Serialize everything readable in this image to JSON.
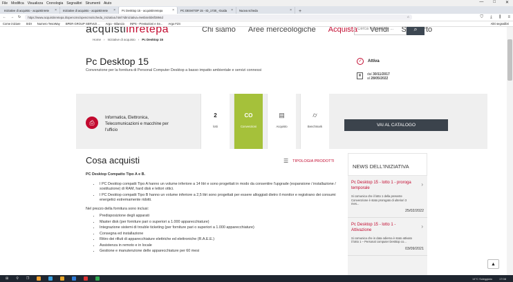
{
  "browser": {
    "menu": [
      "File",
      "Modifica",
      "Visualizza",
      "Cronologia",
      "Segnalibri",
      "Strumenti",
      "Aiuto"
    ],
    "tabs": [
      {
        "label": "Iniziative di acquisto - acquistinrete"
      },
      {
        "label": "Iniziative di acquisto - acquistinrete"
      },
      {
        "label": "Pc Desktop 15 - acquistinretepa"
      },
      {
        "label": "PC DESKTOP 15 - ID_1730_-Guida"
      },
      {
        "label": "Nuova scheda"
      }
    ],
    "url": "https://www.acquistinretepa.it/opencms/opencms/scheda_iniziativa.html?idIniziativa=9e6b4ebb6f3894d",
    "bookmarks": [
      "Come iniziare",
      "SIDI",
      "Numero TesoWay",
      "BPER GROUP SERVIZI ...",
      "Argo - Bilancio",
      "INPS - Prestazioni e Se...",
      "Argo FZ4"
    ],
    "bookmarks_right": "Altri segnalibri",
    "window_controls": [
      "—",
      "□",
      "✕"
    ]
  },
  "site": {
    "logo_a": "acquisti",
    "logo_b": "inrete",
    "logo_c": "pa",
    "nav": [
      "Chi siamo",
      "Aree merceologiche",
      "Acquista",
      "Vendi",
      "Supporto"
    ],
    "search_placeholder": "Cerca nel portale ...",
    "search_icon": "search-icon"
  },
  "breadcrumb": [
    "Home",
    "Iniziative di acquisto",
    "Pc Desktop 15"
  ],
  "page": {
    "title": "Pc Desktop 15",
    "subtitle": "Convenzione per la fornitura di Personal Computer Desktop a basso impatto ambientale e servizi connessi",
    "status": "Attiva",
    "date_from_label": "dal",
    "date_from": "30/11/2017",
    "date_to_label": "al",
    "date_to": "28/05/2022"
  },
  "infobar": {
    "category": "Informatica, Elettronica, Telecomunicazioni e macchine per l'ufficio",
    "lotti_num": "2",
    "lotti_label": "lotti",
    "type_num": "CO",
    "type_label": "Convenzioni",
    "acquisto_label": "Acquisto",
    "benchmark_label": "Benchmark",
    "catalog_button": "VAI AL CATALOGO"
  },
  "section": {
    "title": "Cosa acquisti",
    "tipologia": "TIPOLOGIA PRODOTTI",
    "lead": "PC Desktop Compatto Tipo A e B.",
    "items_a": [
      "I PC Desktop compatti Tipo A hanno un volume inferiore a 14 litri e sono progettati in modo da consentire l'upgrade (espansione / installazione / sostituzione) di RAM, hard disk e lettori ottici.",
      "I PC Desktop compatti Tipo B hanno un volume inferiore a 2,5 litri sono progettati per essere alloggiati dietro il monitor e registrano dei consumi energetici estremamente ridotti."
    ],
    "intro": "Nel prezzo della fornitura sono inclusi:",
    "items_b": [
      "Predisposizione degli apparati",
      "Master disk (per forniture pari o superiori a 1.000 apparecchiature)",
      "Integrazione sistemi di trouble ticketing (per forniture pari o superiori a 1.000 apparecchiature)",
      "Consegna ed installazione",
      "Ritiro dei rifiuti di apparecchiature elettriche ed elettroniche (R.A.E.E.)",
      "Assistenza in remoto e in locale",
      "Gestione e manutenzione delle apparecchiature per 60 mesi"
    ]
  },
  "news": {
    "title": "NEWS DELL'INIZIATIVA",
    "items": [
      {
        "title": "Pc Desktop 15 - lotto 1 - proroga temporale",
        "desc": "Si comunica che il lotto 1 della presente Convenzione è stato prorogato di ulteriori 3 mes...",
        "date": "25/02/2022"
      },
      {
        "title": "Pc Desktop 15 - lotto 1 - Attivazione",
        "desc": "Si comunica che in data odierna è stato attivato il lotto 1 – Personal computer Desktop co...",
        "date": "03/09/2021"
      }
    ]
  },
  "taskbar": {
    "weather": "14°C Soleggiato",
    "time": "17:08"
  }
}
